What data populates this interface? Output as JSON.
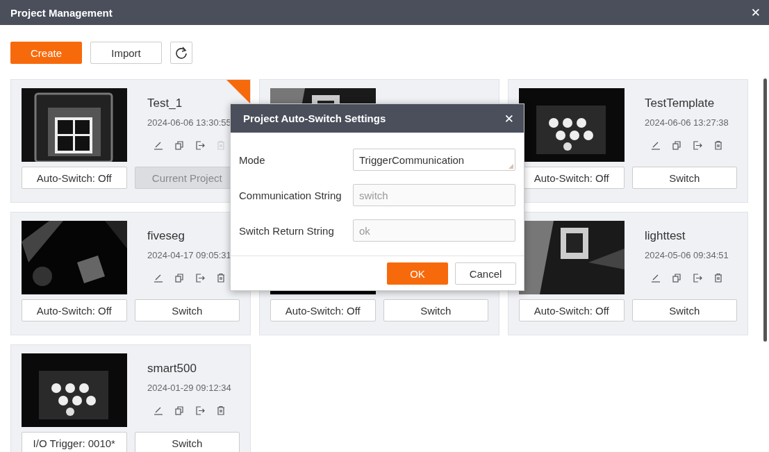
{
  "window": {
    "title": "Project Management",
    "close": "✕"
  },
  "toolbar": {
    "buttons": [
      {
        "label": "Create",
        "kind": "primary"
      },
      {
        "label": "Import",
        "kind": "default"
      }
    ]
  },
  "projects": [
    {
      "name": "Test_1",
      "date": "2024-06-06 13:30:55",
      "current": true,
      "buttons": [
        "Auto-Switch: Off",
        "Current Project"
      ]
    },
    {
      "current": false
    },
    {
      "name": "TestTemplate",
      "date": "2024-06-06 13:27:38",
      "current": false,
      "buttons": [
        "Auto-Switch: Off",
        "Switch"
      ]
    },
    {
      "name": "fiveseg",
      "date": "2024-04-17 09:05:31",
      "current": false,
      "buttons": [
        "Auto-Switch: Off",
        "Switch"
      ]
    },
    {
      "current": false,
      "buttons": [
        "Auto-Switch: Off",
        "Switch"
      ]
    },
    {
      "name": "lighttest",
      "date": "2024-05-06 09:34:51",
      "current": false,
      "buttons": [
        "Auto-Switch: Off",
        "Switch"
      ]
    },
    {
      "name": "smart500",
      "date": "2024-01-29 09:12:34",
      "current": false,
      "buttons": [
        "I/O Trigger: 0010*",
        "Switch"
      ]
    }
  ],
  "dialog": {
    "title": "Project Auto-Switch Settings",
    "close": "✕",
    "fields": [
      {
        "label": "Mode",
        "value": "TriggerCommunication",
        "kind": "select"
      },
      {
        "label": "Communication String",
        "placeholder": "switch",
        "kind": "text"
      },
      {
        "label": "Switch Return String",
        "placeholder": "ok",
        "kind": "text"
      }
    ],
    "buttons": [
      {
        "label": "OK",
        "kind": "primary"
      },
      {
        "label": "Cancel",
        "kind": "default"
      }
    ]
  }
}
